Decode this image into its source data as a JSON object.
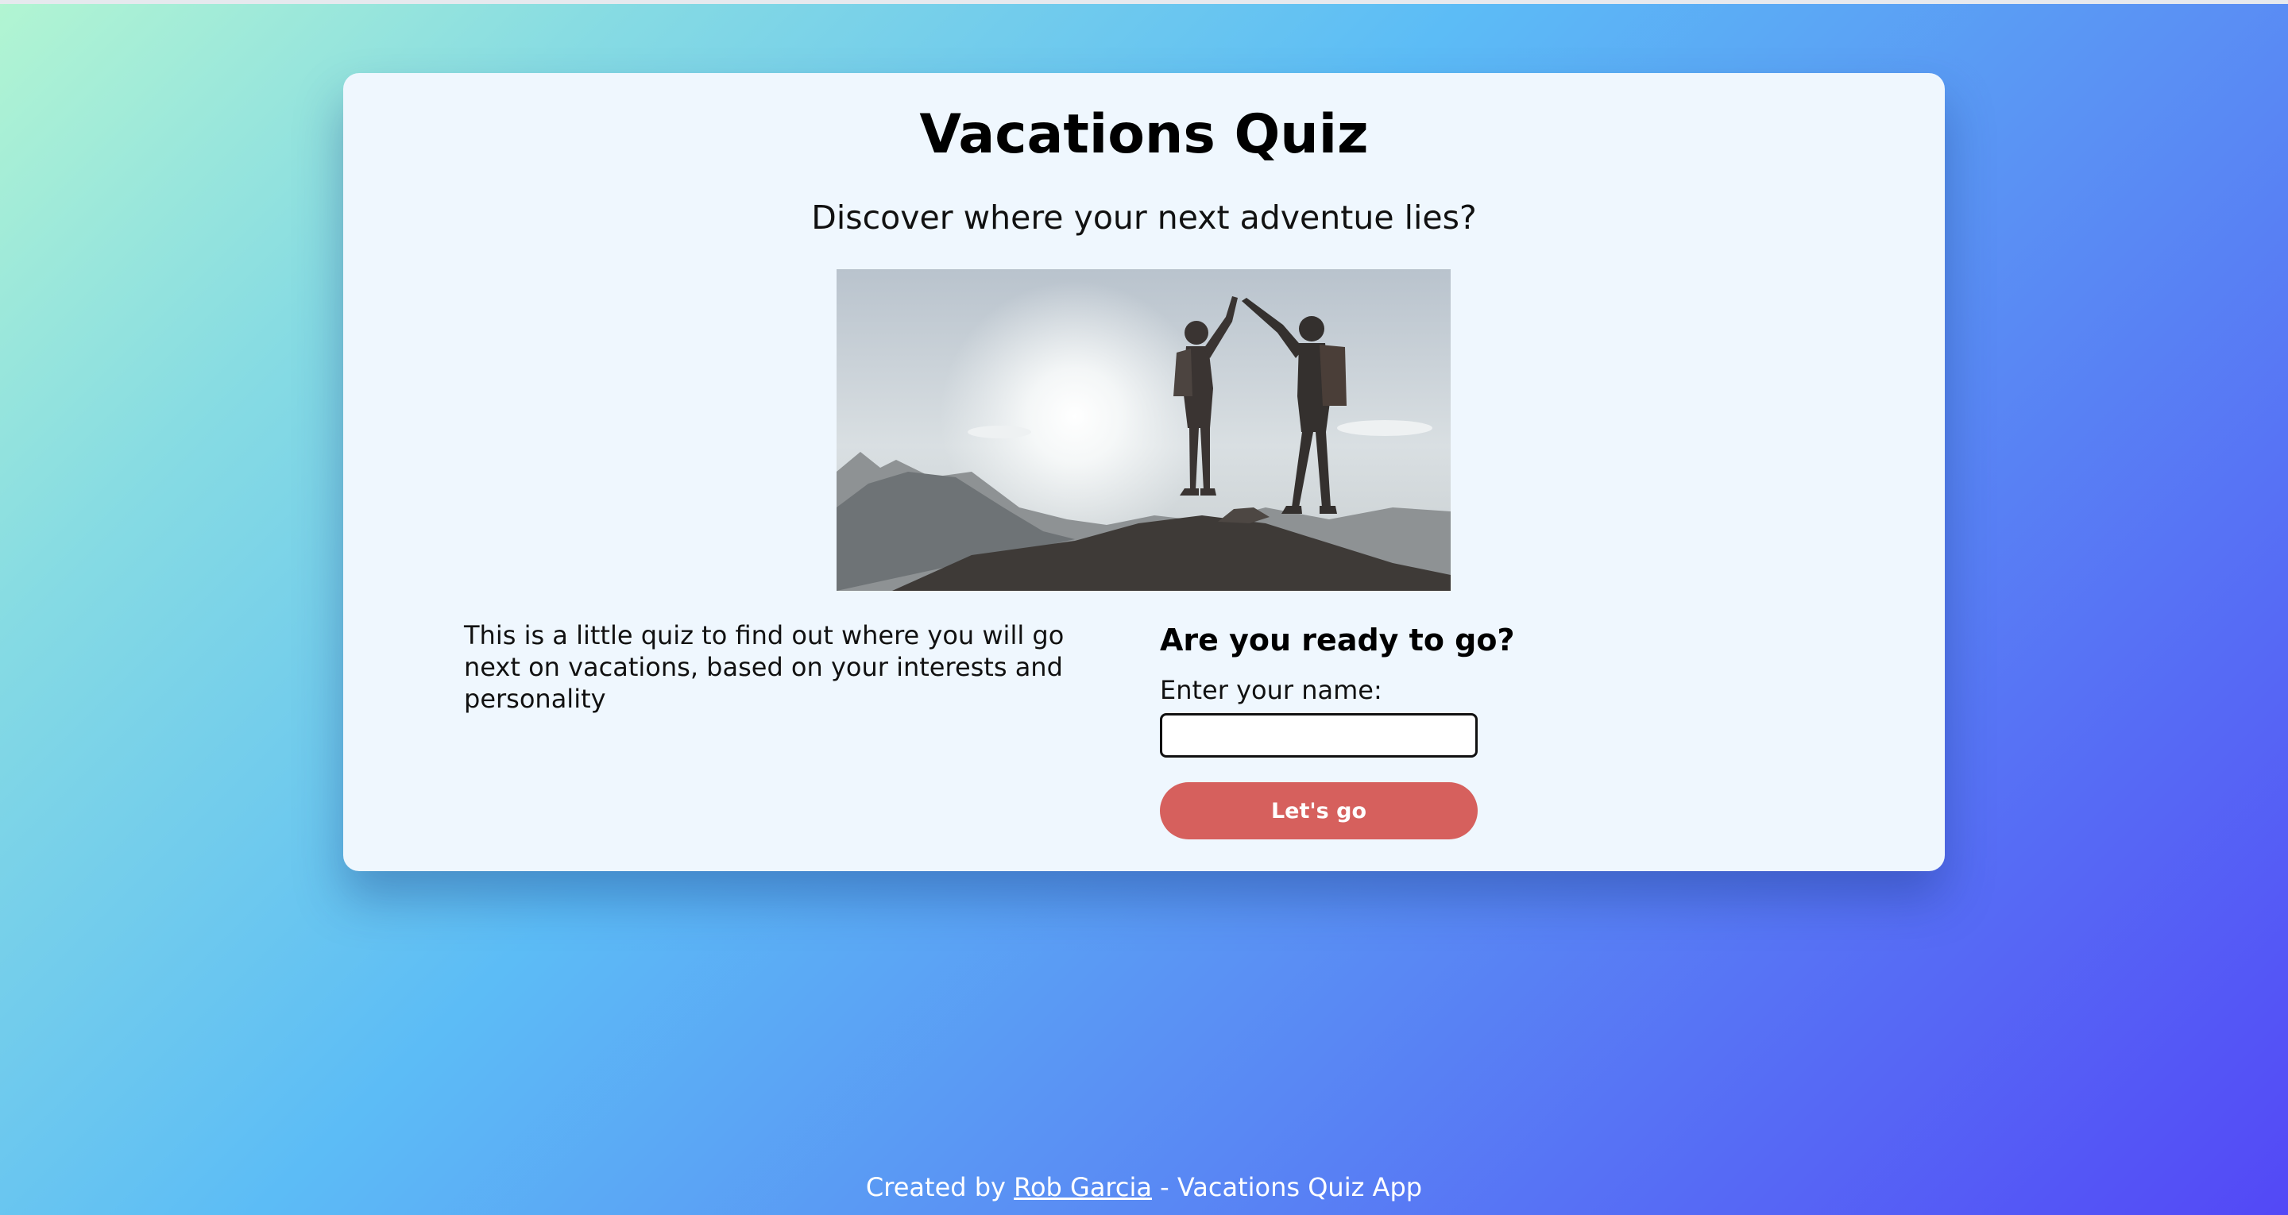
{
  "page": {
    "title": "Vacations Quiz",
    "subtitle": "Discover where your next adventue lies?"
  },
  "hero_image": {
    "icon": "hikers-high-five-image"
  },
  "intro": {
    "description": "This is a little quiz to find out where you will go next on vacations, based on your interests and personality"
  },
  "form": {
    "heading": "Are you ready to go?",
    "name_label": "Enter your name:",
    "name_value": "",
    "name_placeholder": "",
    "submit_label": "Let's go"
  },
  "footer": {
    "prefix": "Created by ",
    "author_link": "Rob Garcia",
    "suffix": " - Vacations Quiz App"
  },
  "colors": {
    "card_background": "#eff7fe",
    "button": "#d6605d",
    "gradient_start": "#b2f5d2",
    "gradient_mid": "#5cbcf6",
    "gradient_end": "#5348f6"
  }
}
